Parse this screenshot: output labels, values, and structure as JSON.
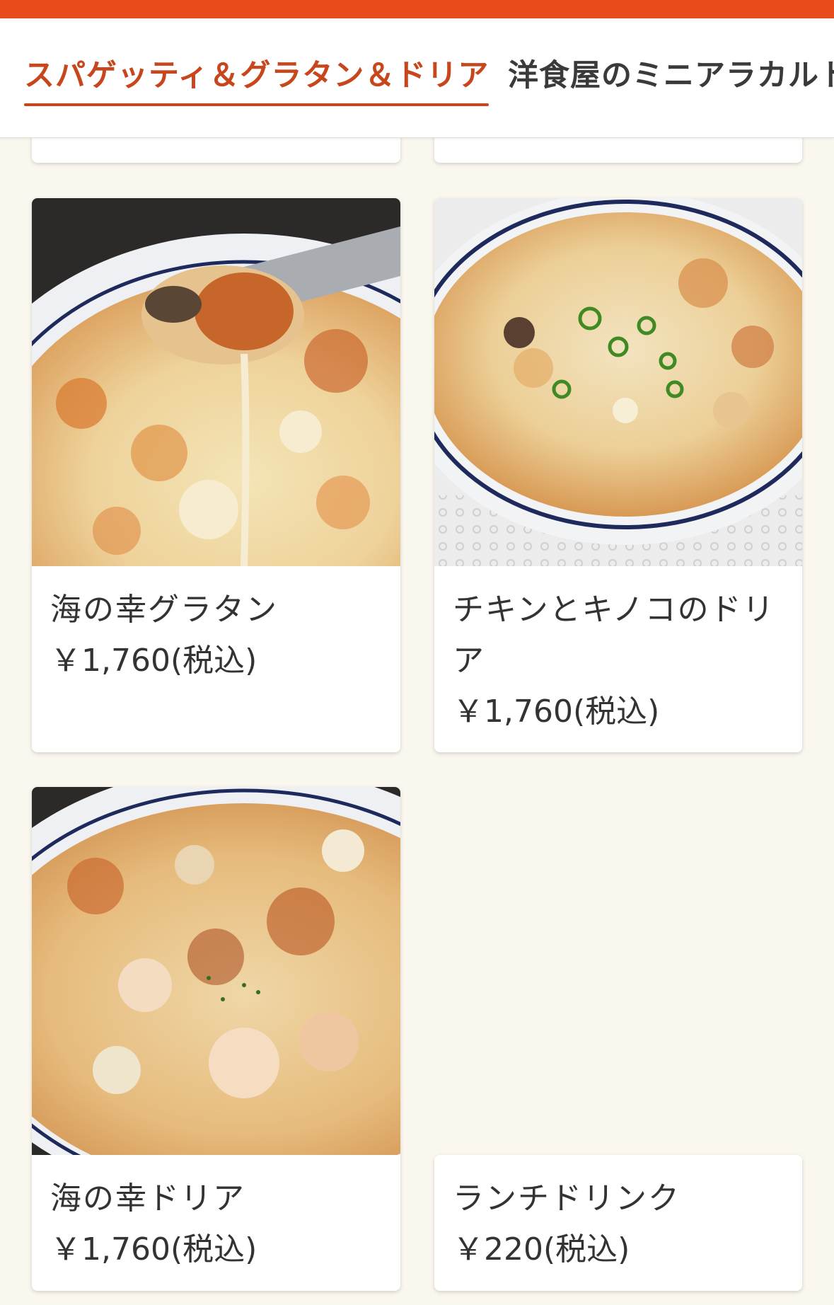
{
  "tabs": [
    {
      "label": "スパゲッティ＆グラタン＆ドリア",
      "active": true
    },
    {
      "label": "洋食屋のミニアラカルト",
      "active": false
    }
  ],
  "menu_items": [
    {
      "name": "海の幸グラタン",
      "price": "￥1,760(税込)",
      "image": "seafood-gratin-photo"
    },
    {
      "name": "チキンとキノコのドリア",
      "price": "￥1,760(税込)",
      "image": "chicken-mushroom-doria-photo"
    },
    {
      "name": "海の幸ドリア",
      "price": "￥1,760(税込)",
      "image": "seafood-doria-photo"
    },
    {
      "name": "ランチドリンク",
      "price": "￥220(税込)"
    }
  ],
  "colors": {
    "accent": "#e84c1a",
    "active_tab": "#c8461c",
    "background": "#faf7ee"
  }
}
